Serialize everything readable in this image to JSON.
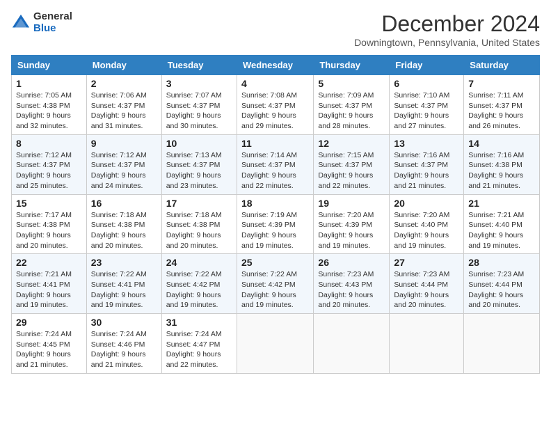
{
  "logo": {
    "general": "General",
    "blue": "Blue"
  },
  "title": "December 2024",
  "location": "Downingtown, Pennsylvania, United States",
  "days_of_week": [
    "Sunday",
    "Monday",
    "Tuesday",
    "Wednesday",
    "Thursday",
    "Friday",
    "Saturday"
  ],
  "weeks": [
    [
      {
        "day": "1",
        "sunrise": "7:05 AM",
        "sunset": "4:38 PM",
        "daylight": "9 hours and 32 minutes."
      },
      {
        "day": "2",
        "sunrise": "7:06 AM",
        "sunset": "4:37 PM",
        "daylight": "9 hours and 31 minutes."
      },
      {
        "day": "3",
        "sunrise": "7:07 AM",
        "sunset": "4:37 PM",
        "daylight": "9 hours and 30 minutes."
      },
      {
        "day": "4",
        "sunrise": "7:08 AM",
        "sunset": "4:37 PM",
        "daylight": "9 hours and 29 minutes."
      },
      {
        "day": "5",
        "sunrise": "7:09 AM",
        "sunset": "4:37 PM",
        "daylight": "9 hours and 28 minutes."
      },
      {
        "day": "6",
        "sunrise": "7:10 AM",
        "sunset": "4:37 PM",
        "daylight": "9 hours and 27 minutes."
      },
      {
        "day": "7",
        "sunrise": "7:11 AM",
        "sunset": "4:37 PM",
        "daylight": "9 hours and 26 minutes."
      }
    ],
    [
      {
        "day": "8",
        "sunrise": "7:12 AM",
        "sunset": "4:37 PM",
        "daylight": "9 hours and 25 minutes."
      },
      {
        "day": "9",
        "sunrise": "7:12 AM",
        "sunset": "4:37 PM",
        "daylight": "9 hours and 24 minutes."
      },
      {
        "day": "10",
        "sunrise": "7:13 AM",
        "sunset": "4:37 PM",
        "daylight": "9 hours and 23 minutes."
      },
      {
        "day": "11",
        "sunrise": "7:14 AM",
        "sunset": "4:37 PM",
        "daylight": "9 hours and 22 minutes."
      },
      {
        "day": "12",
        "sunrise": "7:15 AM",
        "sunset": "4:37 PM",
        "daylight": "9 hours and 22 minutes."
      },
      {
        "day": "13",
        "sunrise": "7:16 AM",
        "sunset": "4:37 PM",
        "daylight": "9 hours and 21 minutes."
      },
      {
        "day": "14",
        "sunrise": "7:16 AM",
        "sunset": "4:38 PM",
        "daylight": "9 hours and 21 minutes."
      }
    ],
    [
      {
        "day": "15",
        "sunrise": "7:17 AM",
        "sunset": "4:38 PM",
        "daylight": "9 hours and 20 minutes."
      },
      {
        "day": "16",
        "sunrise": "7:18 AM",
        "sunset": "4:38 PM",
        "daylight": "9 hours and 20 minutes."
      },
      {
        "day": "17",
        "sunrise": "7:18 AM",
        "sunset": "4:38 PM",
        "daylight": "9 hours and 20 minutes."
      },
      {
        "day": "18",
        "sunrise": "7:19 AM",
        "sunset": "4:39 PM",
        "daylight": "9 hours and 19 minutes."
      },
      {
        "day": "19",
        "sunrise": "7:20 AM",
        "sunset": "4:39 PM",
        "daylight": "9 hours and 19 minutes."
      },
      {
        "day": "20",
        "sunrise": "7:20 AM",
        "sunset": "4:40 PM",
        "daylight": "9 hours and 19 minutes."
      },
      {
        "day": "21",
        "sunrise": "7:21 AM",
        "sunset": "4:40 PM",
        "daylight": "9 hours and 19 minutes."
      }
    ],
    [
      {
        "day": "22",
        "sunrise": "7:21 AM",
        "sunset": "4:41 PM",
        "daylight": "9 hours and 19 minutes."
      },
      {
        "day": "23",
        "sunrise": "7:22 AM",
        "sunset": "4:41 PM",
        "daylight": "9 hours and 19 minutes."
      },
      {
        "day": "24",
        "sunrise": "7:22 AM",
        "sunset": "4:42 PM",
        "daylight": "9 hours and 19 minutes."
      },
      {
        "day": "25",
        "sunrise": "7:22 AM",
        "sunset": "4:42 PM",
        "daylight": "9 hours and 19 minutes."
      },
      {
        "day": "26",
        "sunrise": "7:23 AM",
        "sunset": "4:43 PM",
        "daylight": "9 hours and 20 minutes."
      },
      {
        "day": "27",
        "sunrise": "7:23 AM",
        "sunset": "4:44 PM",
        "daylight": "9 hours and 20 minutes."
      },
      {
        "day": "28",
        "sunrise": "7:23 AM",
        "sunset": "4:44 PM",
        "daylight": "9 hours and 20 minutes."
      }
    ],
    [
      {
        "day": "29",
        "sunrise": "7:24 AM",
        "sunset": "4:45 PM",
        "daylight": "9 hours and 21 minutes."
      },
      {
        "day": "30",
        "sunrise": "7:24 AM",
        "sunset": "4:46 PM",
        "daylight": "9 hours and 21 minutes."
      },
      {
        "day": "31",
        "sunrise": "7:24 AM",
        "sunset": "4:47 PM",
        "daylight": "9 hours and 22 minutes."
      },
      null,
      null,
      null,
      null
    ]
  ]
}
